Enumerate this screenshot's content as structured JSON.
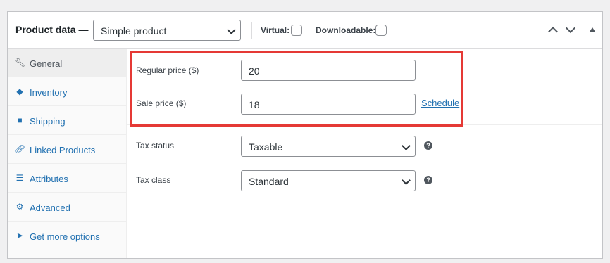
{
  "header": {
    "title": "Product data —",
    "product_type": "Simple product",
    "virtual_label": "Virtual:",
    "downloadable_label": "Downloadable:"
  },
  "sidebar": {
    "items": [
      {
        "label": "General",
        "icon": "wrench-icon",
        "active": true
      },
      {
        "label": "Inventory",
        "icon": "tag-icon"
      },
      {
        "label": "Shipping",
        "icon": "truck-icon"
      },
      {
        "label": "Linked Products",
        "icon": "link-icon"
      },
      {
        "label": "Attributes",
        "icon": "list-icon"
      },
      {
        "label": "Advanced",
        "icon": "gear-icon"
      },
      {
        "label": "Get more options",
        "icon": "plugin-icon"
      }
    ]
  },
  "fields": {
    "regular_price_label": "Regular price ($)",
    "regular_price": "20",
    "sale_price_label": "Sale price ($)",
    "sale_price": "18",
    "schedule": "Schedule",
    "tax_status_label": "Tax status",
    "tax_status": "Taxable",
    "tax_class_label": "Tax class",
    "tax_class": "Standard"
  },
  "colors": {
    "highlight": "#e53935",
    "link": "#2271b1"
  }
}
